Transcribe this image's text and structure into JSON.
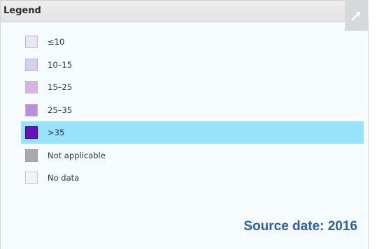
{
  "panel": {
    "title": "Legend",
    "expand_icon": "expand-arrow-icon"
  },
  "legend": {
    "items": [
      {
        "label": "≤10",
        "color": "#e8e6f5"
      },
      {
        "label": "10–15",
        "color": "#d8d0e8"
      },
      {
        "label": "15–25",
        "color": "#d6b4e4"
      },
      {
        "label": "25–35",
        "color": "#b98ddf"
      },
      {
        "label": ">35",
        "color": "#6c0fc2",
        "selected": true
      },
      {
        "label": "Not applicable",
        "color": "#a9a9a9"
      },
      {
        "label": "No data",
        "color": "#f4f4f4"
      }
    ]
  },
  "source": {
    "text": "Source date: 2016",
    "color": "#2e5ea6"
  }
}
